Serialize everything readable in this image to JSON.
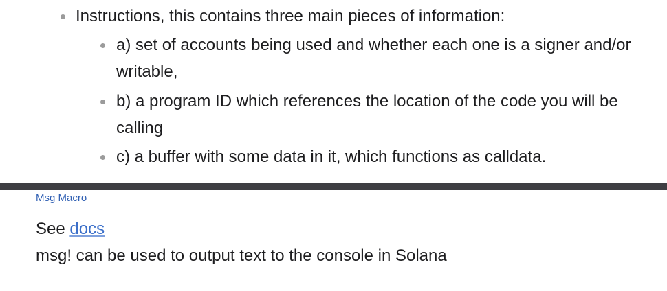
{
  "instructions": {
    "heading": "Instructions, this contains three main pieces of information:",
    "items": [
      {
        "label": "a) set of accounts being used and whether each one is a signer and/or writable,"
      },
      {
        "label": "b) a program ID which references the location of the code you will be calling"
      },
      {
        "label": "c) a buffer with some data in it, which functions as calldata."
      }
    ]
  },
  "msg_macro": {
    "section_label": "Msg Macro",
    "see_prefix": "See",
    "docs_link": "docs",
    "description": "msg! can be used to output text to the console in Solana"
  },
  "colors": {
    "link": "#3b6fc9",
    "label": "#2f5fb3",
    "divider": "#3e3e42",
    "bullet": "#9b9b9b"
  }
}
